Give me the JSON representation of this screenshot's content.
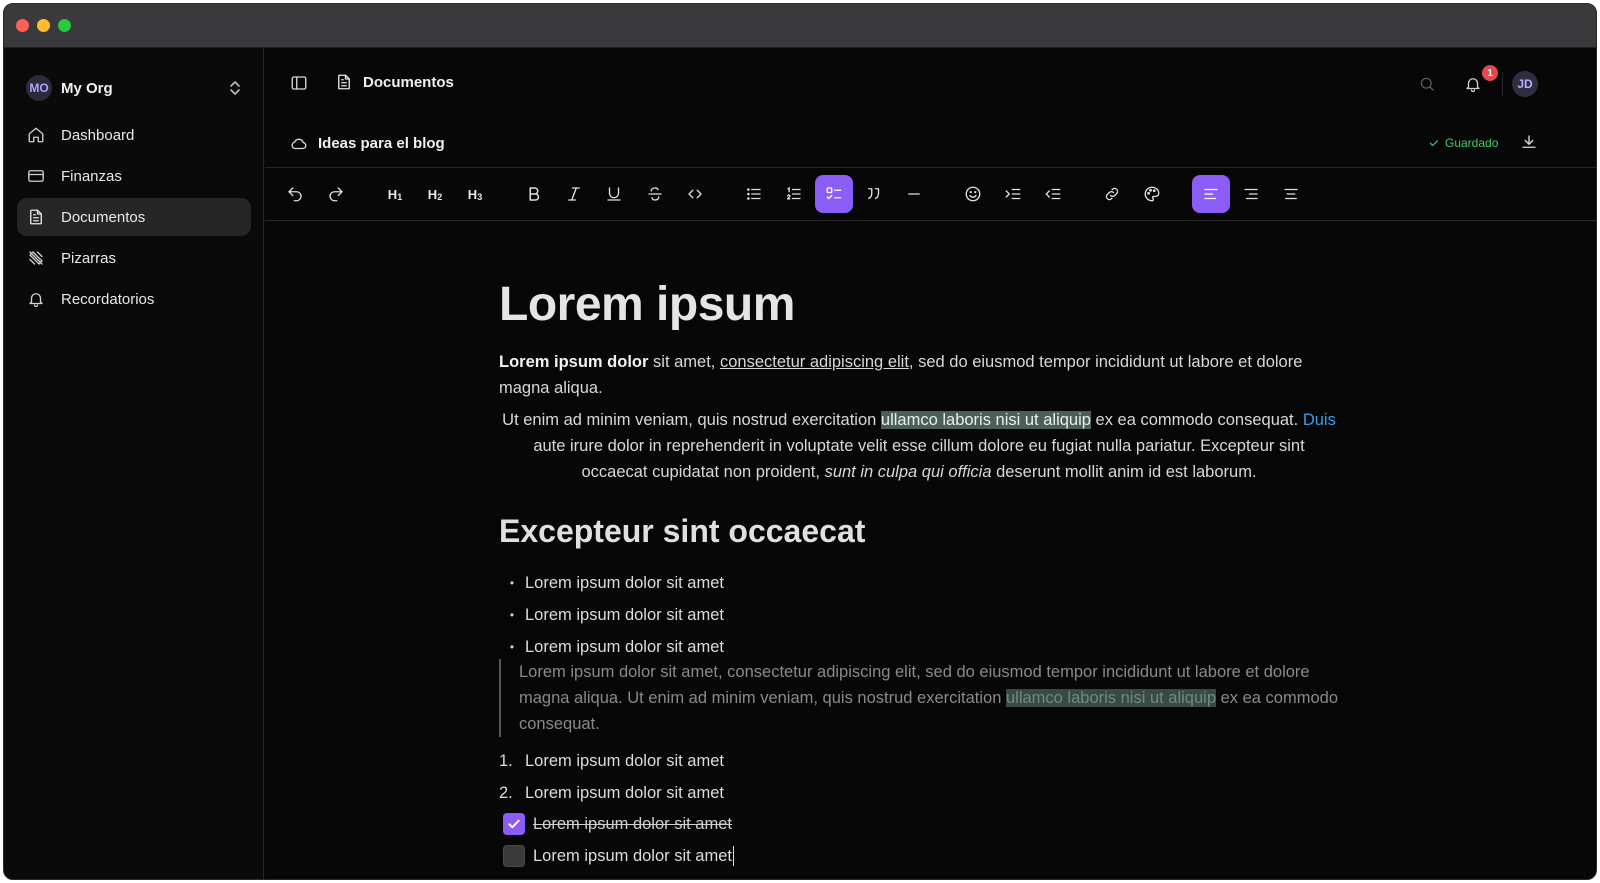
{
  "org": {
    "initials": "MO",
    "name": "My Org"
  },
  "nav": {
    "items": [
      {
        "label": "Dashboard",
        "icon": "home-icon"
      },
      {
        "label": "Finanzas",
        "icon": "card-icon"
      },
      {
        "label": "Documentos",
        "icon": "document-icon",
        "active": true
      },
      {
        "label": "Pizarras",
        "icon": "whiteboard-icon"
      },
      {
        "label": "Recordatorios",
        "icon": "bell-icon"
      }
    ]
  },
  "header": {
    "breadcrumb": "Documentos",
    "notifications_count": "1",
    "user_initials": "JD"
  },
  "doc": {
    "title": "Ideas para el blog",
    "saved_label": "Guardado"
  },
  "toolbar": {
    "h1": "H",
    "h1_sub": "1",
    "h2": "H",
    "h2_sub": "2",
    "h3": "H",
    "h3_sub": "3"
  },
  "content": {
    "heading1": "Lorem ipsum",
    "p1_bold": "Lorem ipsum dolor",
    "p1_a": " sit amet, ",
    "p1_link": "consectetur adipiscing elit",
    "p1_b": ", sed do eiusmod tempor incididunt ut labore et dolore magna aliqua.",
    "p2_a": "Ut enim ad minim veniam, quis nostrud exercitation ",
    "p2_hl": "ullamco laboris nisi ut aliquip",
    "p2_b": " ex ea commodo consequat. ",
    "p2_link": "Duis",
    "p2_c": " aute irure dolor in reprehenderit in voluptate velit esse cillum dolore eu fugiat nulla pariatur. Excepteur sint occaecat cupidatat non proident, ",
    "p2_italic": "sunt in culpa qui officia",
    "p2_d": " deserunt mollit anim id est laborum.",
    "heading2": "Excepteur sint occaecat",
    "bullets": [
      "Lorem ipsum dolor sit amet",
      "Lorem ipsum dolor sit amet",
      "Lorem ipsum dolor sit amet"
    ],
    "quote_a": "Lorem ipsum dolor sit amet, consectetur adipiscing elit, sed do eiusmod tempor incididunt ut labore et dolore magna aliqua. Ut enim ad minim veniam, quis nostrud exercitation ",
    "quote_hl": "ullamco laboris nisi ut aliquip",
    "quote_b": " ex ea commodo consequat.",
    "ordered": [
      {
        "num": "1.",
        "text": "Lorem ipsum dolor sit amet"
      },
      {
        "num": "2.",
        "text": "Lorem ipsum dolor sit amet"
      }
    ],
    "tasks": [
      {
        "text": "Lorem ipsum dolor sit amet",
        "done": true
      },
      {
        "text": "Lorem ipsum dolor sit amet",
        "done": false
      }
    ]
  },
  "colors": {
    "accent": "#8b5cf6",
    "saved": "#3ecf6e",
    "badge": "#e5484d",
    "link": "#3b9ee8"
  }
}
